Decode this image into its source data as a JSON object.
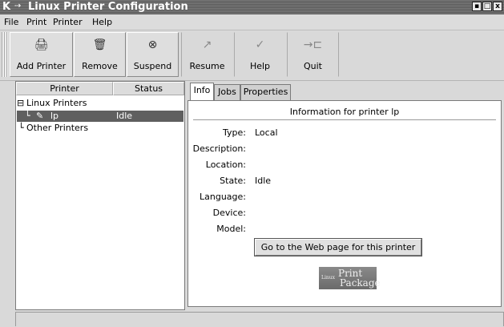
{
  "window": {
    "title": "Linux Printer Configuration",
    "buttons": [
      "▪",
      "□",
      "x"
    ]
  },
  "menu": {
    "items": [
      "File",
      "Print",
      "Printer",
      "Help"
    ]
  },
  "toolbar": {
    "buttons": [
      {
        "label": "Add Printer",
        "icon": "printer-add-icon",
        "glyph": "🖨",
        "enabled": true
      },
      {
        "label": "Remove",
        "icon": "trash-icon",
        "glyph": "🗑",
        "enabled": true
      },
      {
        "label": "Suspend",
        "icon": "suspend-icon",
        "glyph": "⊗",
        "enabled": true
      },
      {
        "label": "Resume",
        "icon": "resume-icon",
        "glyph": "↗",
        "enabled": false
      },
      {
        "label": "Help",
        "icon": "help-icon",
        "glyph": "✓",
        "enabled": false
      },
      {
        "label": "Quit",
        "icon": "quit-icon",
        "glyph": "→⊏",
        "enabled": false
      }
    ]
  },
  "tree": {
    "columns": [
      "Printer",
      "Status"
    ],
    "rows": [
      {
        "expander": "⊟",
        "name": "Linux Printers",
        "status": ""
      },
      {
        "expander": "",
        "name": "lp",
        "status": "Idle"
      },
      {
        "expander": "",
        "name": "Other Printers",
        "status": ""
      }
    ]
  },
  "tabs": [
    "Info",
    "Jobs",
    "Properties"
  ],
  "info": {
    "header": "Information for printer lp",
    "fields": [
      {
        "label": "Type:",
        "value": "Local"
      },
      {
        "label": "Description:",
        "value": ""
      },
      {
        "label": "Location:",
        "value": ""
      },
      {
        "label": "State:",
        "value": "Idle"
      },
      {
        "label": "Language:",
        "value": ""
      },
      {
        "label": "Device:",
        "value": ""
      },
      {
        "label": "Model:",
        "value": ""
      }
    ],
    "web_button": "Go to the Web page for this printer"
  },
  "logo": {
    "small": "Linux",
    "line1": "Print",
    "line2": "Package"
  }
}
